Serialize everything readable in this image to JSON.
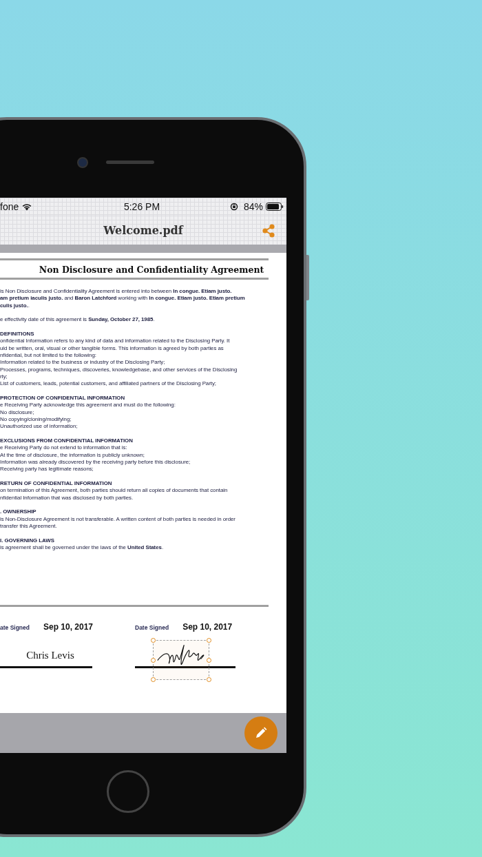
{
  "status_bar": {
    "carrier": "fone",
    "time": "5:26 PM",
    "battery": "84%"
  },
  "nav_bar": {
    "title": "Welcome.pdf"
  },
  "document": {
    "title": "Non Disclosure and Confidentiality Agreement",
    "blocks": [
      {
        "lines": [
          "is Non Disclosure and Confidentiality Agreement is entered into between **In congue. Etiam justo.**",
          "**am pretium iaculis justo.** and **Baron Latchford** working with **In congue. Etiam justo. Etiam pretium**",
          "**culis justo.**."
        ]
      },
      {
        "lines": [
          "e effectivity date of this agreement is **Sunday, October 27, 1985**."
        ]
      },
      {
        "heading": "DEFINITIONS",
        "lines": [
          "onfidential Information refers to any kind of data and information related to the Disclosing Party. It",
          "uld be written, oral, visual or other tangible forms. This information is agreed by both parties as",
          "nfidential, but not limited to the following:",
          "Information related to the business or industry of the Disclosing Party;",
          "Processes, programs, techniques, discoveries, knowledgebase, and other services of the Disclosing",
          "rty;",
          "List of customers, leads, potential customers, and affiliated partners of the Disclosing Party;"
        ]
      },
      {
        "heading": "PROTECTION OF CONFIDENTIAL INFORMATION",
        "lines": [
          "e Receiving Party acknowledge this agreement and must do the following:",
          "No disclosure;",
          "No copying/cloning/modifying;",
          "Unauthorized use of information;"
        ]
      },
      {
        "heading": "EXCLUSIONS FROM CONFIDENTIAL INFORMATION",
        "lines": [
          "e Receiving Party do not extend to information that is:",
          "At the time of disclosure, the information is publicly unknown;",
          "Information was already discovered by the receiving party before this disclosure;",
          "Receiving party has legitimate reasons;"
        ]
      },
      {
        "heading": "RETURN OF CONFIDENTIAL INFORMATION",
        "lines": [
          "on termination of this Agreement, both parties should return all copies of documents that contain",
          "nfidential Information that was disclosed by both parties."
        ]
      },
      {
        "heading": ". OWNERSHIP",
        "lines": [
          "is Non-Disclosure Agreement is not transferable. A written content of both parties is needed in order",
          "transfer this Agreement."
        ]
      },
      {
        "heading": "I. GOVERNING LAWS",
        "lines": [
          "is agreement shall be governed under the laws of the **United States**."
        ]
      }
    ],
    "signatures": [
      {
        "label": "ate Signed",
        "date": "Sep 10, 2017",
        "kind": "typed",
        "name": "Chris Levis"
      },
      {
        "label": "Date Signed",
        "date": "Sep 10, 2017",
        "kind": "drawn",
        "selected": true
      }
    ]
  }
}
